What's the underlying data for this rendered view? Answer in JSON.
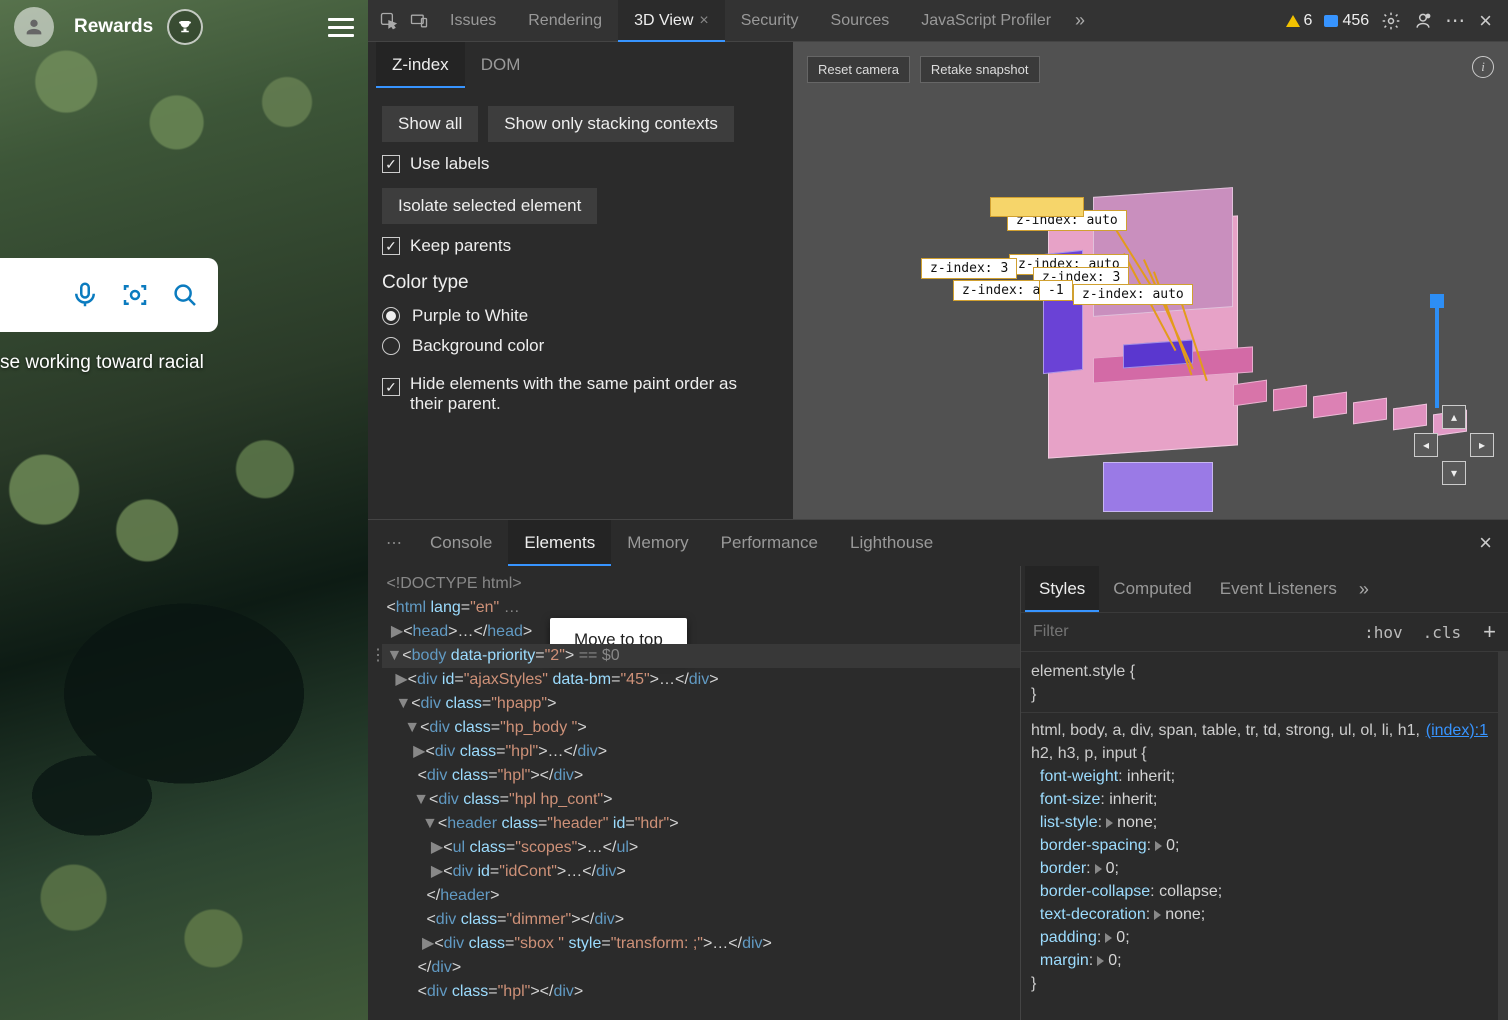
{
  "page": {
    "rewards_label": "Rewards",
    "caption_text": "se working toward racial"
  },
  "devtools": {
    "tabs": {
      "issues": "Issues",
      "rendering": "Rendering",
      "view3d": "3D View",
      "security": "Security",
      "sources": "Sources",
      "jsprofiler": "JavaScript Profiler"
    },
    "warn_count": "6",
    "info_count": "456"
  },
  "zpanel": {
    "tabs": {
      "zindex": "Z-index",
      "dom": "DOM"
    },
    "show_all": "Show all",
    "show_stacking": "Show only stacking contexts",
    "use_labels": "Use labels",
    "isolate": "Isolate selected element",
    "keep_parents": "Keep parents",
    "color_type": "Color type",
    "purple_white": "Purple to White",
    "background_color": "Background color",
    "hide_same": "Hide elements with the same paint order as their parent."
  },
  "canvas": {
    "reset": "Reset camera",
    "retake": "Retake snapshot",
    "labels": {
      "a": "z-index: auto",
      "b": "z-index: auto",
      "c": "z-index: 3",
      "d": "z-index: 3",
      "e": "z-index: auto",
      "f": "-1",
      "g": "z-index: auto"
    }
  },
  "drawer": {
    "tabs": {
      "console": "Console",
      "elements": "Elements",
      "memory": "Memory",
      "performance": "Performance",
      "lighthouse": "Lighthouse"
    },
    "tooltip": "Move to top"
  },
  "dom_text": {
    "doctype": "<!DOCTYPE html>",
    "body_comment": "== $0"
  },
  "styles": {
    "tabs": {
      "styles": "Styles",
      "computed": "Computed",
      "listeners": "Event Listeners"
    },
    "filter_ph": "Filter",
    "hov": ":hov",
    "cls": ".cls",
    "elstyle": "element.style {",
    "selectors": "html, body, a, div, span, table, tr, td, strong, ul, ol, li, h1, h2, h3, p, input {",
    "srclink": "(index):1",
    "props": {
      "fw": "font-weight",
      "fwv": "inherit;",
      "fs": "font-size",
      "fsv": "inherit;",
      "ls": "list-style",
      "lsv": "none;",
      "bs": "border-spacing",
      "bsv": "0;",
      "bd": "border",
      "bdv": "0;",
      "bc": "border-collapse",
      "bcv": "collapse;",
      "td": "text-decoration",
      "tdv": "none;",
      "pd": "padding",
      "pdv": "0;",
      "mg": "margin",
      "mgv": "0;"
    }
  }
}
